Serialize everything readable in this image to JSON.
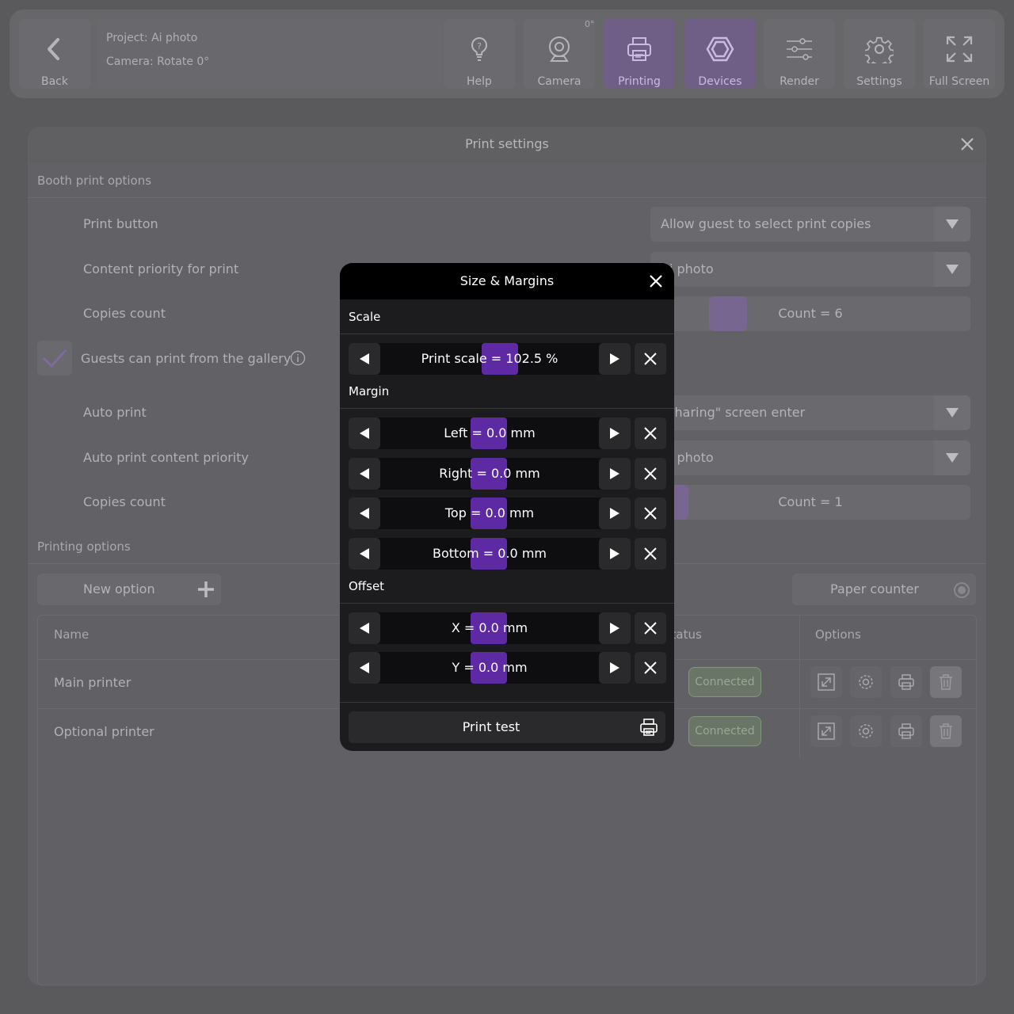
{
  "topbar": {
    "back_label": "Back",
    "project": "Project: Ai photo",
    "camera": "Camera: Rotate 0°",
    "angle_badge": "0°",
    "buttons": [
      {
        "label": "Help",
        "icon": "help-icon"
      },
      {
        "label": "Camera",
        "icon": "webcam-icon"
      },
      {
        "label": "Printing",
        "icon": "printer-icon",
        "active": true
      },
      {
        "label": "Devices",
        "icon": "hexagon-icon",
        "active": true
      },
      {
        "label": "Render",
        "icon": "sliders-icon"
      },
      {
        "label": "Settings",
        "icon": "gear-icon"
      },
      {
        "label": "Full Screen",
        "icon": "fullscreen-icon"
      }
    ]
  },
  "panel": {
    "title": "Print settings",
    "booth_section": "Booth print options",
    "rows": {
      "print_button": "Print button",
      "content_priority": "Content priority for print",
      "copies_count": "Copies count",
      "gallery": "Guests can print from the gallery",
      "auto_print": "Auto print",
      "auto_priority": "Auto print content priority",
      "copies_count_2": "Copies count"
    },
    "selects": {
      "print_button_value": "Allow guest to select print copies",
      "content_priority_value": "Ai photo",
      "auto_print_value": "\"Sharing\" screen enter",
      "auto_priority_value": "Ai photo"
    },
    "counts": {
      "copies": "Count = 6",
      "auto_copies": "Count = 1"
    },
    "printing_section": "Printing options",
    "new_option": "New option",
    "paper_counter": "Paper counter",
    "table": {
      "headers": {
        "name": "Name",
        "status": "Status",
        "options": "Options"
      },
      "rows": [
        {
          "name": "Main printer",
          "status": "Connected"
        },
        {
          "name": "Optional printer",
          "status": "Connected"
        }
      ]
    }
  },
  "modal": {
    "title": "Size & Margins",
    "scale_section": "Scale",
    "margin_section": "Margin",
    "offset_section": "Offset",
    "print_scale": "Print scale = 102.5 %",
    "left": "Left = 0.0 mm",
    "right": "Right = 0.0 mm",
    "top": "Top = 0.0 mm",
    "bottom": "Bottom = 0.0 mm",
    "x": "X = 0.0 mm",
    "y": "Y = 0.0 mm",
    "print_test": "Print test"
  },
  "colors": {
    "accent": "#5e2aa3",
    "active_tab": "#6f5e85",
    "status_connected": "#7e9a7a",
    "modal_bg": "#1c1c1e"
  }
}
